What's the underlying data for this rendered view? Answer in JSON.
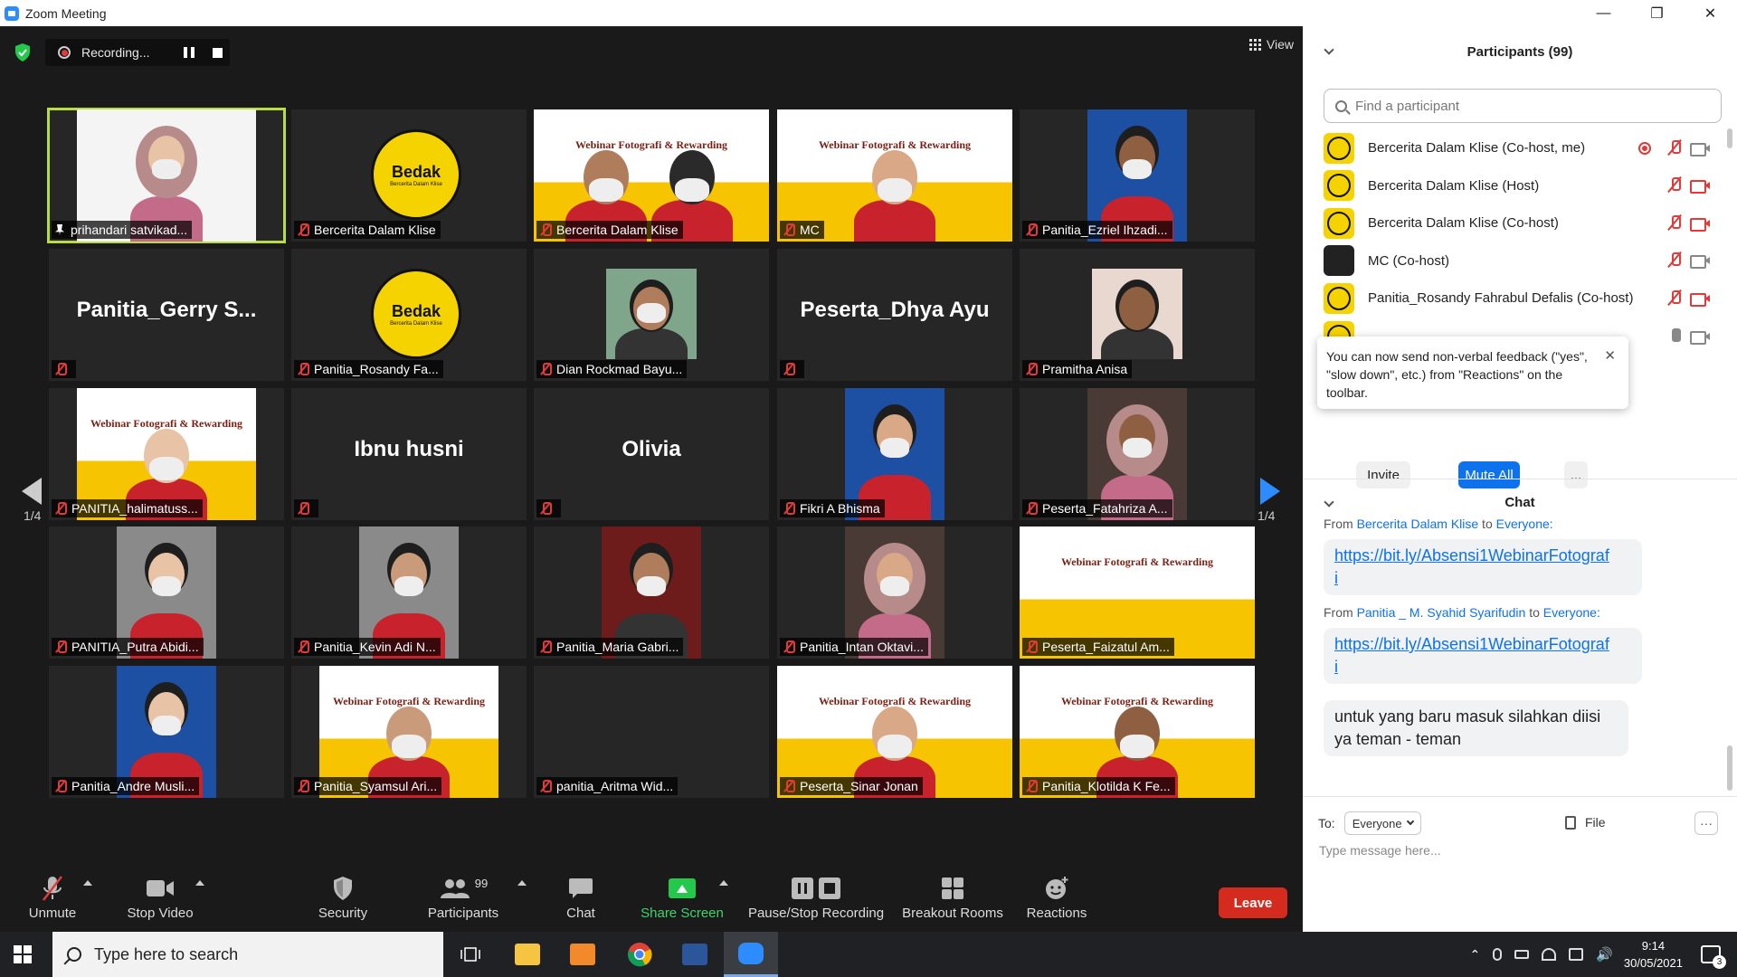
{
  "window": {
    "title": "Zoom Meeting"
  },
  "recording": {
    "label": "Recording..."
  },
  "view": {
    "label": "View"
  },
  "tiles": [
    {
      "name": "prihandari satvikad...",
      "active": true,
      "pinned": true,
      "kind": "person-hijab",
      "big": ""
    },
    {
      "name": "Bercerita Dalam Klise",
      "kind": "logo",
      "big": ""
    },
    {
      "name": "Bercerita Dalam Klise",
      "kind": "banner-two",
      "big": ""
    },
    {
      "name": "MC",
      "kind": "banner-person",
      "big": ""
    },
    {
      "name": "Panitia_Ezriel Ihzadi...",
      "kind": "person-blue",
      "big": ""
    },
    {
      "name": "",
      "kind": "text",
      "big": "Panitia_Gerry S..."
    },
    {
      "name": "Panitia_Rosandy Fa...",
      "kind": "logo",
      "big": ""
    },
    {
      "name": "Dian Rockmad Bayu...",
      "kind": "person-outdoor",
      "big": ""
    },
    {
      "name": "",
      "kind": "text",
      "big": "Peserta_Dhya Ayu"
    },
    {
      "name": "Pramitha Anisa",
      "kind": "cartoon",
      "big": ""
    },
    {
      "name": "PANITIA_halimatuss...",
      "kind": "banner-person",
      "big": ""
    },
    {
      "name": "",
      "kind": "text",
      "big": "Ibnu husni"
    },
    {
      "name": "",
      "kind": "text",
      "big": "Olivia"
    },
    {
      "name": "Fikri A Bhisma",
      "kind": "person-blue",
      "big": ""
    },
    {
      "name": "Peserta_Fatahriza A...",
      "kind": "person-hijab-dark",
      "big": ""
    },
    {
      "name": "PANITIA_Putra Abidi...",
      "kind": "person-red",
      "big": ""
    },
    {
      "name": "Panitia_Kevin Adi N...",
      "kind": "person-red",
      "big": ""
    },
    {
      "name": "Panitia_Maria Gabri...",
      "kind": "person-dark",
      "big": ""
    },
    {
      "name": "Panitia_Intan Oktavi...",
      "kind": "person-hijab-dark",
      "big": ""
    },
    {
      "name": "Peserta_Faizatul Am...",
      "kind": "banner",
      "big": ""
    },
    {
      "name": "Panitia_Andre Musli...",
      "kind": "person-blue",
      "big": ""
    },
    {
      "name": "Panitia_Syamsul Ari...",
      "kind": "banner-person",
      "big": ""
    },
    {
      "name": "panitia_Aritma Wid...",
      "kind": "empty",
      "big": ""
    },
    {
      "name": "Peserta_Sinar Jonan",
      "kind": "banner-person",
      "big": ""
    },
    {
      "name": "Panitia_Klotilda K Fe...",
      "kind": "banner-person",
      "big": ""
    }
  ],
  "banner_text": "Webinar Fotografi & Rewarding",
  "logo_text": {
    "title": "Bedak",
    "sub": "Bercerita Dalam Klise"
  },
  "pages": {
    "left": "1/4",
    "right": "1/4"
  },
  "toolbar": {
    "unmute": "Unmute",
    "stop_video": "Stop Video",
    "security": "Security",
    "participants": "Participants",
    "participants_count": "99",
    "chat": "Chat",
    "share_screen": "Share Screen",
    "pause_stop_recording": "Pause/Stop Recording",
    "breakout_rooms": "Breakout Rooms",
    "reactions": "Reactions",
    "leave": "Leave"
  },
  "participants_panel": {
    "title": "Participants (99)",
    "search_placeholder": "Find a participant",
    "rows": [
      {
        "name": "Bercerita Dalam Klise (Co-host, me)",
        "avatar": "logo",
        "rec": true,
        "mic": "muted",
        "cam": "on"
      },
      {
        "name": "Bercerita Dalam Klise (Host)",
        "avatar": "logo",
        "rec": false,
        "mic": "muted",
        "cam": "off"
      },
      {
        "name": "Bercerita Dalam Klise (Co-host)",
        "avatar": "logo",
        "rec": false,
        "mic": "muted",
        "cam": "off"
      },
      {
        "name": "MC (Co-host)",
        "avatar": "dark",
        "rec": false,
        "mic": "muted",
        "cam": "on"
      },
      {
        "name": "Panitia_Rosandy Fahrabul Defalis (Co-host)",
        "avatar": "logo",
        "rec": false,
        "mic": "muted",
        "cam": "off"
      },
      {
        "name": "",
        "avatar": "logo",
        "rec": false,
        "mic": "on",
        "cam": "on"
      }
    ],
    "tooltip": "You can now send non-verbal feedback (\"yes\", \"slow down\", etc.) from \"Reactions\" on the toolbar.",
    "tooltip_close": "✕",
    "invite": "Invite",
    "mute_all": "Mute All",
    "more": "..."
  },
  "chat_panel": {
    "title": "Chat",
    "messages": [
      {
        "from_prefix": "From ",
        "from_name": "Bercerita Dalam Klise",
        "to_word": " to ",
        "to_name": "Everyone:",
        "link_line1": "https://bit.ly/Absensi1WebinarFotograf",
        "link_line2": "i"
      },
      {
        "from_prefix": "From ",
        "from_name": "Panitia _ M. Syahid Syarifudin",
        "to_word": " to ",
        "to_name": "Everyone:",
        "link_line1": "https://bit.ly/Absensi1WebinarFotograf",
        "link_line2": "i"
      }
    ],
    "last_bubble_line1": "untuk yang baru masuk silahkan diisi",
    "last_bubble_line2": "ya teman - teman",
    "to_label": "To:",
    "to_value": "Everyone",
    "file_label": "File",
    "more": "···",
    "input_placeholder": "Type message here..."
  },
  "taskbar": {
    "search_placeholder": "Type here to search",
    "time": "9:14",
    "date": "30/05/2021",
    "notif_count": "3"
  }
}
